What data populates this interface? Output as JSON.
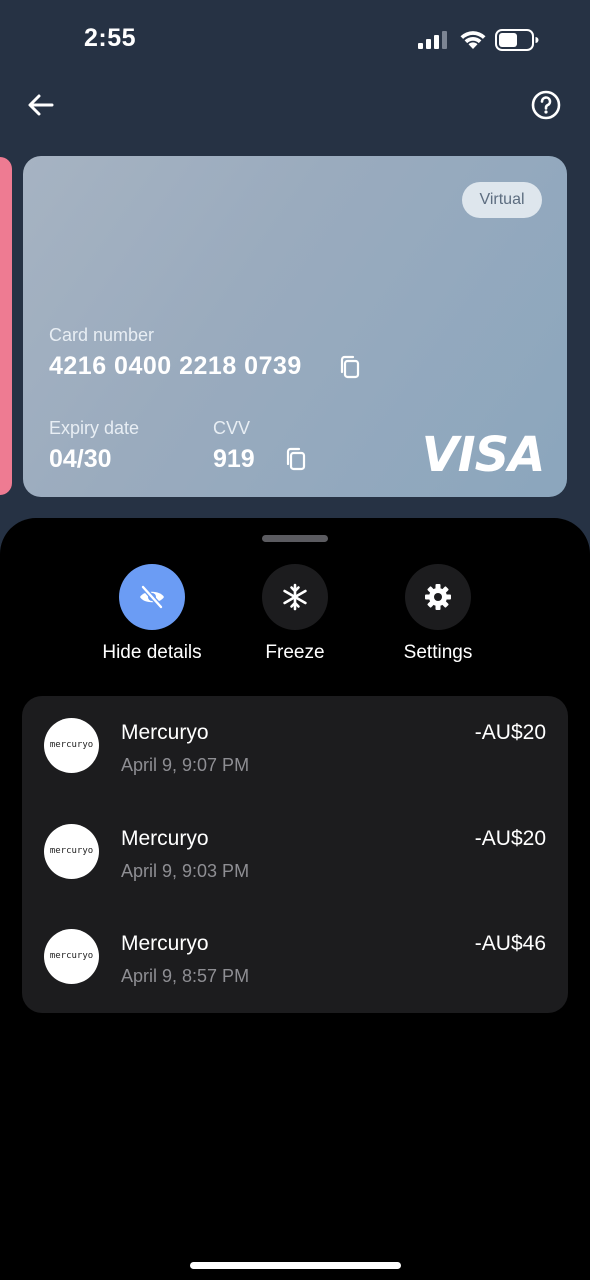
{
  "status_bar": {
    "time": "2:55"
  },
  "header": {
    "back_icon": "arrow-left-icon",
    "help_icon": "question-circle-icon"
  },
  "card": {
    "badge": "Virtual",
    "number_label": "Card number",
    "number": "4216 0400 2218 0739",
    "expiry_label": "Expiry date",
    "expiry": "04/30",
    "cvv_label": "CVV",
    "cvv": "919",
    "network": "VISA",
    "copy_icon": "copy-icon"
  },
  "actions": [
    {
      "label": "Hide details",
      "icon": "eye-off-icon",
      "color": "#6b9cf4"
    },
    {
      "label": "Freeze",
      "icon": "snowflake-icon",
      "color": "#1c1c1e"
    },
    {
      "label": "Settings",
      "icon": "gear-icon",
      "color": "#1c1c1e"
    }
  ],
  "transactions": [
    {
      "logo": "mercuryo",
      "merchant": "Mercuryo",
      "date": "April 9, 9:07 PM",
      "amount": "-AU$20"
    },
    {
      "logo": "mercuryo",
      "merchant": "Mercuryo",
      "date": "April 9, 9:03 PM",
      "amount": "-AU$20"
    },
    {
      "logo": "mercuryo",
      "merchant": "Mercuryo",
      "date": "April 9, 8:57 PM",
      "amount": "-AU$46"
    }
  ],
  "colors": {
    "header_bg": "#263244",
    "accent": "#6b9cf4",
    "side_card": "#ee7b92"
  }
}
